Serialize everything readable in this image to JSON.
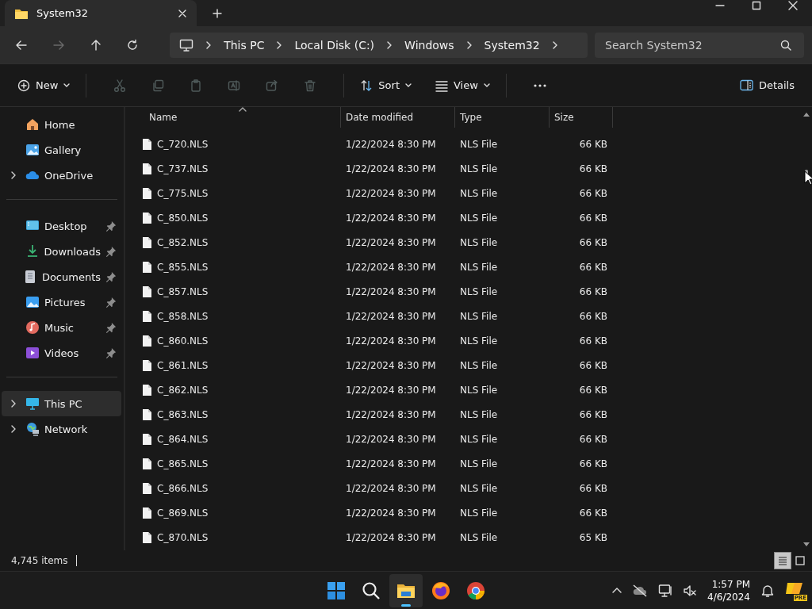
{
  "tab": {
    "title": "System32"
  },
  "address": {
    "crumbs": [
      "This PC",
      "Local Disk (C:)",
      "Windows",
      "System32"
    ]
  },
  "search": {
    "placeholder": "Search System32"
  },
  "toolbar": {
    "new_label": "New",
    "actions": [
      {
        "disabled": true
      },
      {
        "disabled": true
      },
      {
        "disabled": true
      },
      {
        "disabled": true
      },
      {
        "disabled": true
      },
      {
        "disabled": true
      }
    ],
    "sort_label": "Sort",
    "view_label": "View",
    "details_label": "Details"
  },
  "sidebar": {
    "groups": [
      [
        {
          "label": "Home",
          "expandable": false,
          "pinned": false,
          "selected": false
        },
        {
          "label": "Gallery",
          "expandable": false,
          "pinned": false,
          "selected": false
        },
        {
          "label": "OneDrive",
          "expandable": true,
          "pinned": false,
          "selected": false
        }
      ],
      [
        {
          "label": "Desktop",
          "expandable": false,
          "pinned": true,
          "selected": false
        },
        {
          "label": "Downloads",
          "expandable": false,
          "pinned": true,
          "selected": false
        },
        {
          "label": "Documents",
          "expandable": false,
          "pinned": true,
          "selected": false
        },
        {
          "label": "Pictures",
          "expandable": false,
          "pinned": true,
          "selected": false
        },
        {
          "label": "Music",
          "expandable": false,
          "pinned": true,
          "selected": false
        },
        {
          "label": "Videos",
          "expandable": false,
          "pinned": true,
          "selected": false
        }
      ],
      [
        {
          "label": "This PC",
          "expandable": true,
          "pinned": false,
          "selected": true
        },
        {
          "label": "Network",
          "expandable": true,
          "pinned": false,
          "selected": false
        }
      ]
    ]
  },
  "table": {
    "columns": [
      "Name",
      "Date modified",
      "Type",
      "Size"
    ],
    "rows": [
      {
        "name": "C_720.NLS",
        "date": "1/22/2024 8:30 PM",
        "type": "NLS File",
        "size": "66 KB"
      },
      {
        "name": "C_737.NLS",
        "date": "1/22/2024 8:30 PM",
        "type": "NLS File",
        "size": "66 KB"
      },
      {
        "name": "C_775.NLS",
        "date": "1/22/2024 8:30 PM",
        "type": "NLS File",
        "size": "66 KB"
      },
      {
        "name": "C_850.NLS",
        "date": "1/22/2024 8:30 PM",
        "type": "NLS File",
        "size": "66 KB"
      },
      {
        "name": "C_852.NLS",
        "date": "1/22/2024 8:30 PM",
        "type": "NLS File",
        "size": "66 KB"
      },
      {
        "name": "C_855.NLS",
        "date": "1/22/2024 8:30 PM",
        "type": "NLS File",
        "size": "66 KB"
      },
      {
        "name": "C_857.NLS",
        "date": "1/22/2024 8:30 PM",
        "type": "NLS File",
        "size": "66 KB"
      },
      {
        "name": "C_858.NLS",
        "date": "1/22/2024 8:30 PM",
        "type": "NLS File",
        "size": "66 KB"
      },
      {
        "name": "C_860.NLS",
        "date": "1/22/2024 8:30 PM",
        "type": "NLS File",
        "size": "66 KB"
      },
      {
        "name": "C_861.NLS",
        "date": "1/22/2024 8:30 PM",
        "type": "NLS File",
        "size": "66 KB"
      },
      {
        "name": "C_862.NLS",
        "date": "1/22/2024 8:30 PM",
        "type": "NLS File",
        "size": "66 KB"
      },
      {
        "name": "C_863.NLS",
        "date": "1/22/2024 8:30 PM",
        "type": "NLS File",
        "size": "66 KB"
      },
      {
        "name": "C_864.NLS",
        "date": "1/22/2024 8:30 PM",
        "type": "NLS File",
        "size": "66 KB"
      },
      {
        "name": "C_865.NLS",
        "date": "1/22/2024 8:30 PM",
        "type": "NLS File",
        "size": "66 KB"
      },
      {
        "name": "C_866.NLS",
        "date": "1/22/2024 8:30 PM",
        "type": "NLS File",
        "size": "66 KB"
      },
      {
        "name": "C_869.NLS",
        "date": "1/22/2024 8:30 PM",
        "type": "NLS File",
        "size": "66 KB"
      },
      {
        "name": "C_870.NLS",
        "date": "1/22/2024 8:30 PM",
        "type": "NLS File",
        "size": "65 KB"
      }
    ]
  },
  "status_bar": {
    "count": "4,745 items",
    "views": [
      {
        "selected": true
      },
      {
        "selected": false
      }
    ]
  },
  "taskbar": {
    "apps": [
      {
        "active": false
      },
      {
        "active": false
      },
      {
        "active": true
      },
      {
        "active": false
      },
      {
        "active": false
      }
    ],
    "time": "1:57 PM",
    "date": "4/6/2024",
    "badge": "PRE"
  }
}
